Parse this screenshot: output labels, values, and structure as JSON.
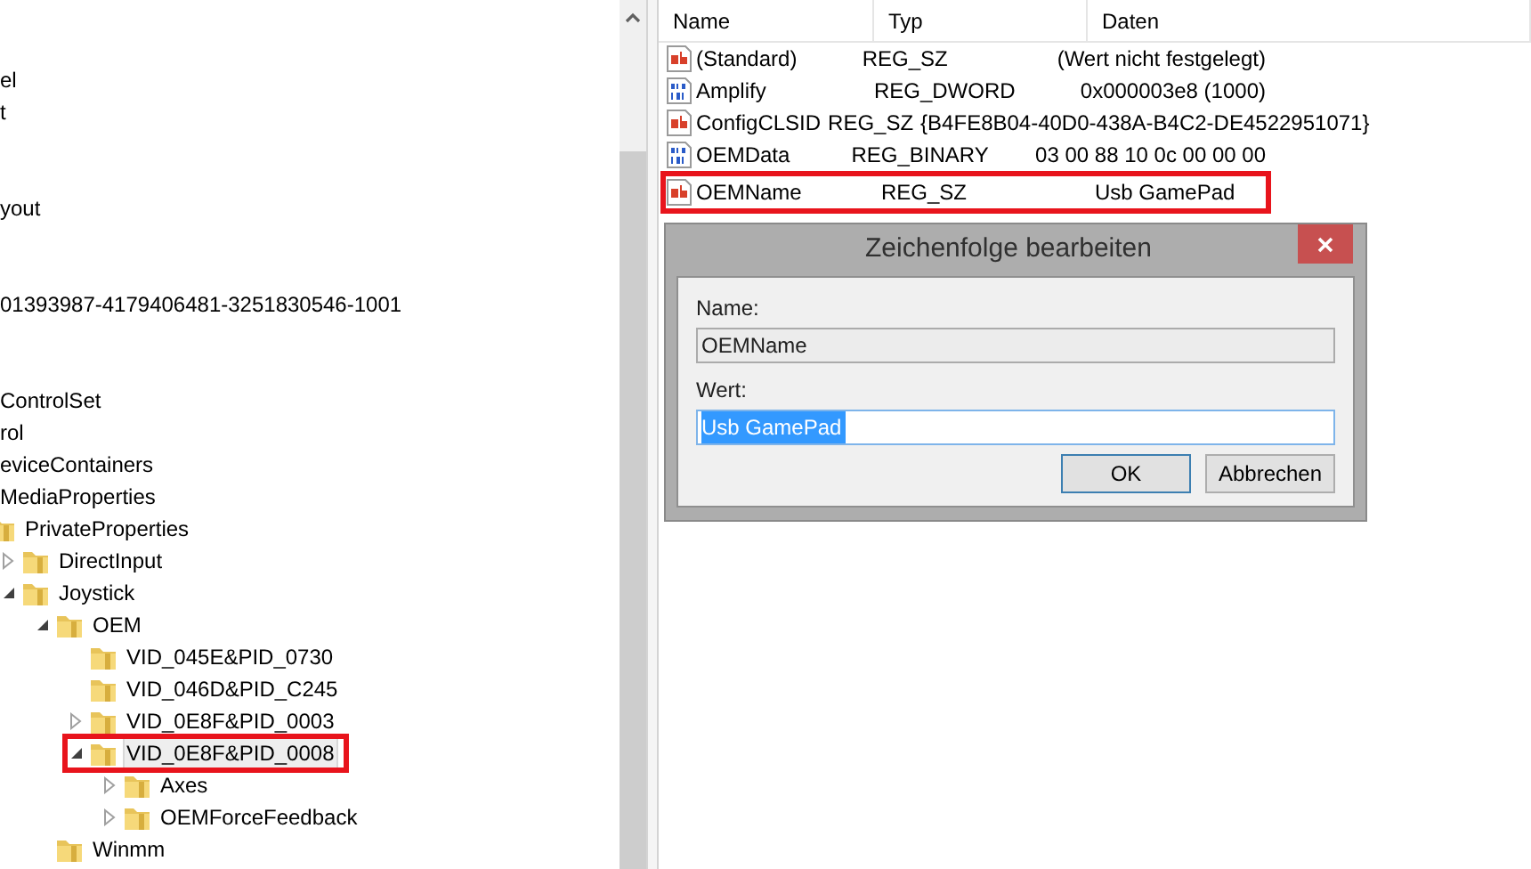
{
  "tree": {
    "clipped_items": [
      {
        "label": "el"
      },
      {
        "label": "t"
      },
      {
        "label": "yout"
      },
      {
        "label": "01393987-4179406481-3251830546-1001"
      },
      {
        "label": "ControlSet"
      },
      {
        "label": "rol"
      },
      {
        "label": "eviceContainers"
      },
      {
        "label": "MediaProperties"
      }
    ],
    "items": [
      {
        "label": "PrivateProperties",
        "selected": false,
        "annotated": false,
        "children": [
          {
            "label": "DirectInput",
            "expandable": true,
            "expanded": false,
            "selected": false,
            "annotated": false
          },
          {
            "label": "Joystick",
            "expandable": true,
            "expanded": true,
            "selected": false,
            "annotated": false,
            "children": [
              {
                "label": "OEM",
                "expandable": true,
                "expanded": true,
                "selected": false,
                "annotated": false,
                "children": [
                  {
                    "label": "VID_045E&PID_0730",
                    "expandable": false,
                    "selected": false,
                    "annotated": false
                  },
                  {
                    "label": "VID_046D&PID_C245",
                    "expandable": false,
                    "selected": false,
                    "annotated": false
                  },
                  {
                    "label": "VID_0E8F&PID_0003",
                    "expandable": true,
                    "expanded": false,
                    "selected": false,
                    "annotated": false
                  },
                  {
                    "label": "VID_0E8F&PID_0008",
                    "expandable": true,
                    "expanded": true,
                    "selected": true,
                    "annotated": true,
                    "children": [
                      {
                        "label": "Axes",
                        "expandable": true,
                        "expanded": false,
                        "selected": false,
                        "annotated": false
                      },
                      {
                        "label": "OEMForceFeedback",
                        "expandable": true,
                        "expanded": false,
                        "selected": false,
                        "annotated": false
                      }
                    ]
                  }
                ]
              },
              {
                "label": "Winmm",
                "expandable": false,
                "selected": false,
                "annotated": false
              }
            ]
          }
        ]
      }
    ]
  },
  "list": {
    "columns": [
      "Name",
      "Typ",
      "Daten"
    ],
    "rows": [
      {
        "name": "(Standard)",
        "type": "REG_SZ",
        "data": "(Wert nicht festgelegt)",
        "kind": "string",
        "annotated": false
      },
      {
        "name": "Amplify",
        "type": "REG_DWORD",
        "data": "0x000003e8 (1000)",
        "kind": "binary",
        "annotated": false
      },
      {
        "name": "ConfigCLSID",
        "type": "REG_SZ",
        "data": "{B4FE8B04-40D0-438A-B4C2-DE4522951071}",
        "kind": "string",
        "annotated": false
      },
      {
        "name": "OEMData",
        "type": "REG_BINARY",
        "data": "03 00 88 10 0c 00 00 00",
        "kind": "binary",
        "annotated": false
      },
      {
        "name": "OEMName",
        "type": "REG_SZ",
        "data": "Usb GamePad",
        "kind": "string",
        "annotated": true
      }
    ]
  },
  "dialog": {
    "title": "Zeichenfolge bearbeiten",
    "name_label": "Name:",
    "name_value": "OEMName",
    "value_label": "Wert:",
    "value": "Usb GamePad",
    "value_selected": true,
    "buttons": [
      {
        "label": "OK",
        "default": true
      },
      {
        "label": "Abbrechen",
        "default": false
      }
    ]
  }
}
